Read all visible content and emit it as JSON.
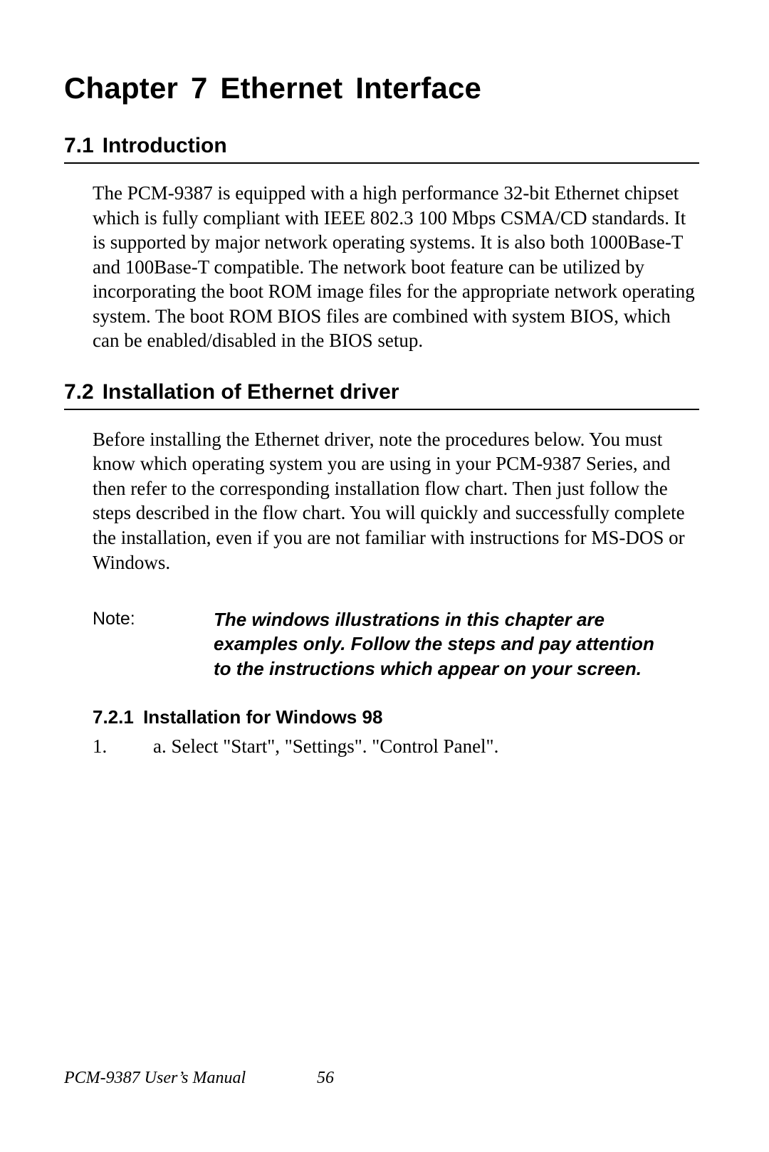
{
  "chapter": {
    "label": "Chapter",
    "number": "7",
    "title": "Ethernet Interface"
  },
  "sections": {
    "s1": {
      "number": "7.1",
      "title": "Introduction",
      "body": "The PCM-9387 is equipped with a high performance 32-bit Ethernet chipset which is fully compliant with IEEE 802.3 100 Mbps CSMA/CD standards. It is supported by major network operating systems. It is also both 1000Base-T and 100Base-T compatible. The network boot feature can be utilized by incorporating the boot ROM image files for the appropriate network operating system. The boot ROM BIOS files are combined with system BIOS, which can be enabled/disabled in the BIOS setup."
    },
    "s2": {
      "number": "7.2",
      "title": "Installation of Ethernet driver",
      "body": "Before installing the Ethernet driver, note the procedures below. You must know which operating system you are using in your PCM-9387 Series, and then refer to the corresponding installation flow chart. Then just follow the steps described in the flow chart. You will quickly and successfully complete the installation, even if you are not familiar with instructions for MS-DOS or Windows.",
      "note_label": "Note:",
      "note_text": "The windows illustrations in this chapter are examples only. Follow the steps and pay attention to the instructions which appear on your screen.",
      "sub": {
        "number": "7.2.1",
        "title": "Installation for Windows 98",
        "step_num": "1.",
        "step_text": "a. Select \"Start\", \"Settings\". \"Control Panel\"."
      }
    }
  },
  "footer": {
    "manual": "PCM-9387 User’s Manual",
    "page": "56"
  }
}
